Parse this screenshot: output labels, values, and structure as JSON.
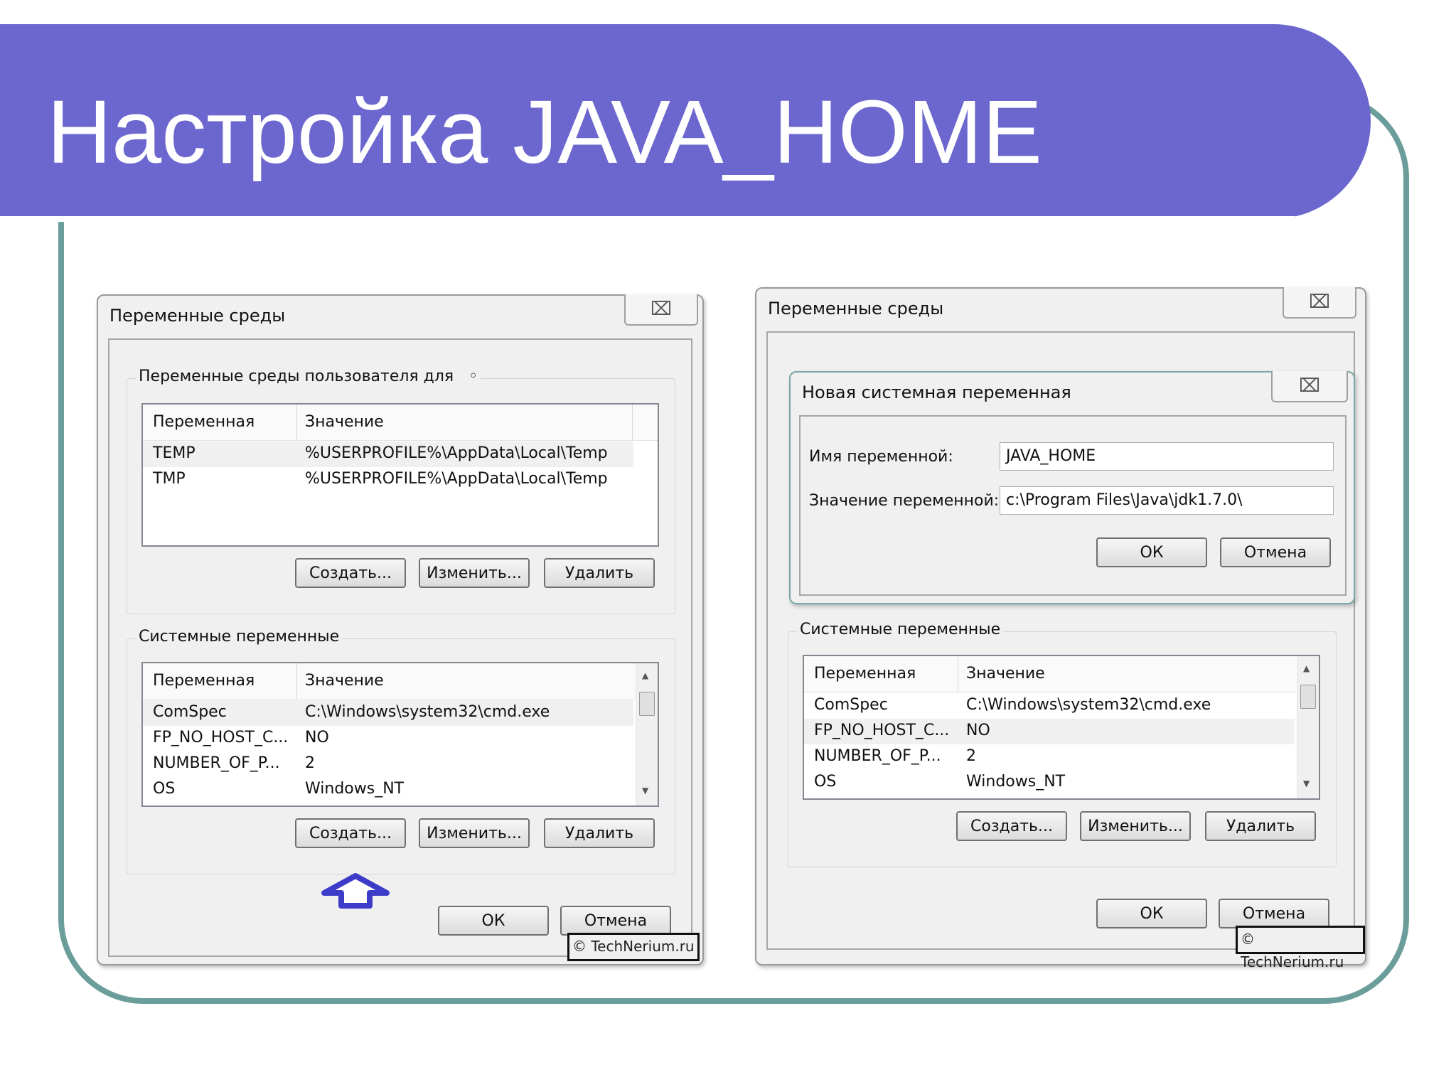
{
  "slide": {
    "title": "Настройка JAVA_HOME"
  },
  "left_dialog": {
    "title": "Переменные среды",
    "close_glyph": "⌧",
    "user_group": {
      "label": "Переменные среды пользователя для",
      "col_name": "Переменная",
      "col_value": "Значение",
      "rows": [
        {
          "name": "TEMP",
          "value": "%USERPROFILE%\\AppData\\Local\\Temp"
        },
        {
          "name": "TMP",
          "value": "%USERPROFILE%\\AppData\\Local\\Temp"
        }
      ],
      "buttons": {
        "create": "Создать...",
        "edit": "Изменить...",
        "delete": "Удалить"
      }
    },
    "system_group": {
      "label": "Системные переменные",
      "col_name": "Переменная",
      "col_value": "Значение",
      "rows": [
        {
          "name": "ComSpec",
          "value": "C:\\Windows\\system32\\cmd.exe"
        },
        {
          "name": "FP_NO_HOST_C...",
          "value": "NO"
        },
        {
          "name": "NUMBER_OF_P...",
          "value": "2"
        },
        {
          "name": "OS",
          "value": "Windows_NT"
        }
      ],
      "buttons": {
        "create": "Создать...",
        "edit": "Изменить...",
        "delete": "Удалить"
      }
    },
    "ok": "ОК",
    "cancel": "Отмена",
    "watermark": "© TechNerium.ru"
  },
  "right_dialog": {
    "title": "Переменные среды",
    "close_glyph": "⌧",
    "new_var_dialog": {
      "title": "Новая системная переменная",
      "close_glyph": "⌧",
      "name_label": "Имя переменной:",
      "name_value": "JAVA_HOME",
      "value_label": "Значение переменной:",
      "value_value": "c:\\Program Files\\Java\\jdk1.7.0\\",
      "ok": "ОК",
      "cancel": "Отмена"
    },
    "system_group": {
      "label": "Системные переменные",
      "col_name": "Переменная",
      "col_value": "Значение",
      "rows": [
        {
          "name": "ComSpec",
          "value": "C:\\Windows\\system32\\cmd.exe"
        },
        {
          "name": "FP_NO_HOST_C...",
          "value": "NO"
        },
        {
          "name": "NUMBER_OF_P...",
          "value": "2"
        },
        {
          "name": "OS",
          "value": "Windows_NT"
        }
      ],
      "buttons": {
        "create": "Создать...",
        "edit": "Изменить...",
        "delete": "Удалить"
      }
    },
    "ok": "ОК",
    "cancel": "Отмена",
    "watermark": "© TechNerium.ru"
  },
  "colors": {
    "banner": "#6b67cf",
    "frame": "#6b9e9b",
    "arrow": "#3c3cc8"
  }
}
